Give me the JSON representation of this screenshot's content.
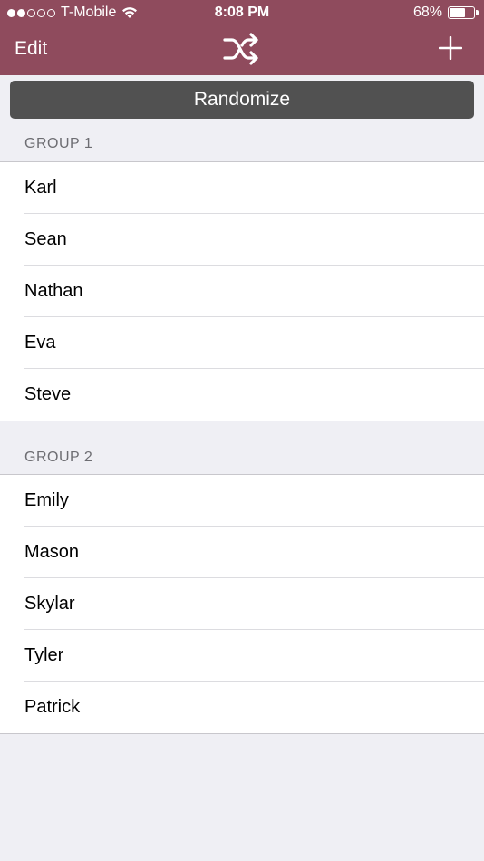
{
  "status": {
    "carrier": "T-Mobile",
    "time": "8:08 PM",
    "battery": "68%",
    "battery_level": 0.68
  },
  "nav": {
    "edit_label": "Edit",
    "center_icon": "shuffle-icon",
    "right_icon": "plus-icon"
  },
  "randomize_label": "Randomize",
  "groups": [
    {
      "title": "GROUP 1",
      "members": [
        "Karl",
        "Sean",
        "Nathan",
        "Eva",
        "Steve"
      ]
    },
    {
      "title": "GROUP 2",
      "members": [
        "Emily",
        "Mason",
        "Skylar",
        "Tyler",
        "Patrick"
      ]
    }
  ],
  "colors": {
    "nav_background": "#8f4b5d",
    "button_background": "#515151",
    "page_background": "#efeff4"
  }
}
